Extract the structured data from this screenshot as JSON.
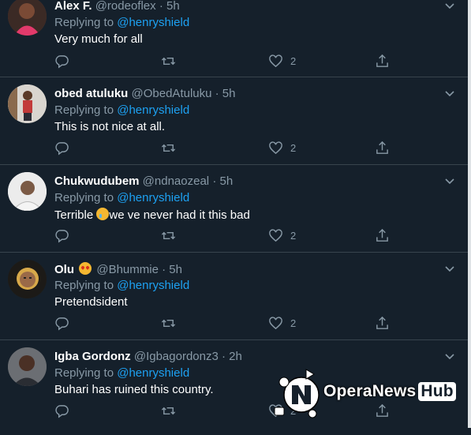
{
  "tweets": [
    {
      "name": "Alex F.",
      "handle": "@rodeoflex",
      "time": "· 5h",
      "replying_prefix": "Replying to",
      "replying_to": "@henryshield",
      "text": "Very much for all",
      "likes": "2"
    },
    {
      "name": "obed atuluku",
      "handle": "@ObedAtuluku",
      "time": "· 5h",
      "replying_prefix": "Replying to",
      "replying_to": "@henryshield",
      "text": "This is not nice at all.",
      "likes": "2"
    },
    {
      "name": "Chukwudubem",
      "handle": "@ndnaozeal",
      "time": "· 5h",
      "replying_prefix": "Replying to",
      "replying_to": "@henryshield",
      "text_before": "Terrible ",
      "text_after": "we ve never had it this bad",
      "likes": "2"
    },
    {
      "name": "Olu",
      "handle": "@Bhummie",
      "time": "· 5h",
      "replying_prefix": "Replying to",
      "replying_to": "@henryshield",
      "text": "Pretendsident",
      "likes": "2"
    },
    {
      "name": "Igba Gordonz",
      "handle": "@Igbagordonz3",
      "time": "· 2h",
      "replying_prefix": "Replying to",
      "replying_to": "@henryshield",
      "text": "Buhari has ruined this country.",
      "likes": "2"
    }
  ],
  "icons": {
    "reply": "reply-icon",
    "retweet": "retweet-icon",
    "like": "heart-icon",
    "share": "share-icon",
    "more": "chevron-down-icon"
  },
  "colors": {
    "background": "#15202b",
    "link": "#1da1f2",
    "secondary_text": "#8899a6",
    "divider": "#38444d"
  },
  "watermark": {
    "brand": "OperaNews",
    "hub": "Hub"
  }
}
